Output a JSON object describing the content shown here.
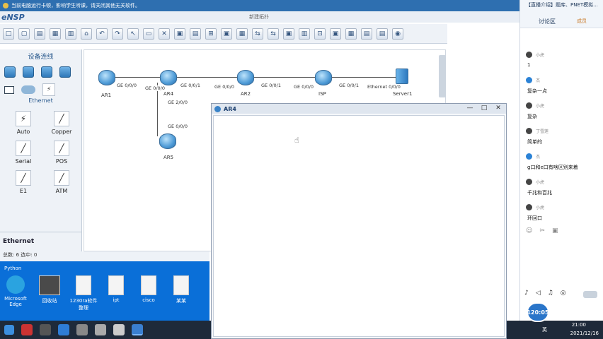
{
  "notice": "当前电脑运行卡顿，影响学生听课，请关闭其他无关软件。",
  "app": {
    "logo": "eNSP",
    "window_title": "新建拓扑"
  },
  "toolbar": [
    "□",
    "▢",
    "▤",
    "▦",
    "▥",
    "⌂",
    "↶",
    "↷",
    "↖",
    "▭",
    "✕",
    "▣",
    "▤",
    "⊞",
    "▣",
    "▦",
    "⇆",
    "⇆",
    "▣",
    "▥",
    "⊡",
    "▣",
    "▦",
    "▤",
    "▤",
    "◉"
  ],
  "left_panel": {
    "title": "设备连线",
    "ethernet_label": "Ethernet",
    "cables": [
      "Auto",
      "Copper",
      "Serial",
      "POS",
      "E1",
      "ATM"
    ],
    "footer": "Ethernet"
  },
  "topology": {
    "devices": [
      "AR1",
      "AR4",
      "AR2",
      "ISP",
      "Server1",
      "AR5"
    ],
    "ports": [
      "GE 0/0/0",
      "GE 0/0/0",
      "GE 0/0/1",
      "GE 0/0/0",
      "GE 0/0/1",
      "GE 0/0/0",
      "GE 0/0/1",
      "Ethernet 0/0/0",
      "GE 2/0/0",
      "GE 0/0/0"
    ]
  },
  "status_bar": "总数: 6  选中: 0",
  "desktop": {
    "title": "Python",
    "icons": [
      "Microsoft Edge",
      "回收站",
      "1230ra软件整理",
      "ipt",
      "cisco",
      "某某"
    ]
  },
  "ar4_window": {
    "title": "AR4",
    "min": "—",
    "max": "□",
    "close": "✕"
  },
  "right_panel": {
    "title": "【直播介绍】题库、PNET模拟...",
    "tab_active": "讨论区",
    "tab_other": "成员",
    "messages": [
      {
        "name": "小虎",
        "text": "1"
      },
      {
        "name": "杰",
        "text": "复杂一点"
      },
      {
        "name": "小虎",
        "text": "复杂"
      },
      {
        "name": "丁雪莲",
        "text": "简单的"
      },
      {
        "name": "杰",
        "text": "g口和e口有啥区别来着"
      },
      {
        "name": "小虎",
        "text": "千兆和百兆"
      },
      {
        "name": "小虎",
        "text": "环回口"
      }
    ]
  },
  "timer": "120:05",
  "tray": {
    "time": "21:00",
    "date": "2021/12/16",
    "ime": "英"
  },
  "colors": {
    "notice": "#2e6fb0",
    "desktop": "#0a6fd8",
    "taskbar": "#1e2a3a",
    "accent": "#2b82d6"
  }
}
